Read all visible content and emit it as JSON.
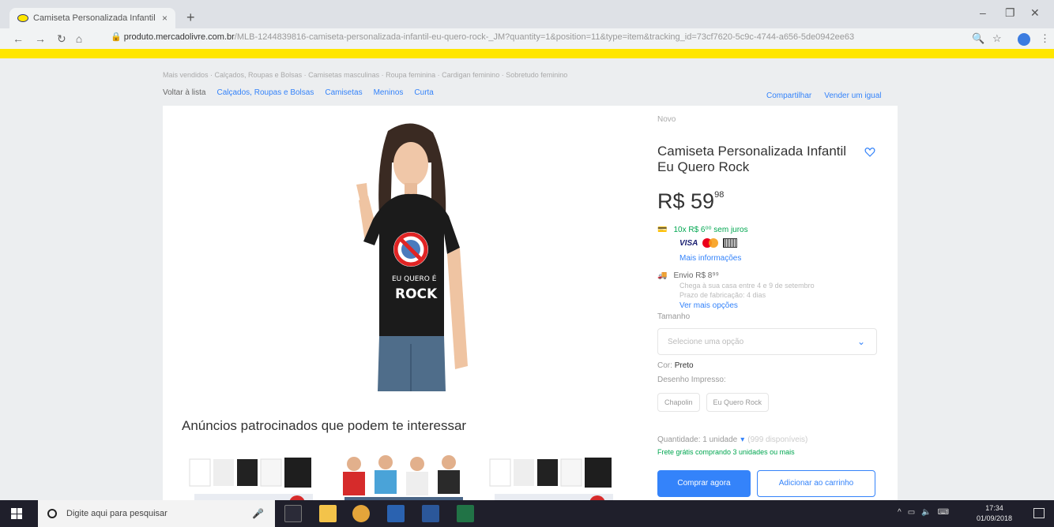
{
  "browser": {
    "tab_title": "Camiseta Personalizada Infantil",
    "tab_close": "×",
    "new_tab": "+",
    "url_host": "produto.mercadolivre.com.br",
    "url_path": "/MLB-1244839816-camiseta-personalizada-infantil-eu-quero-rock-_JM?quantity=1&position=11&type=item&tracking_id=73cf7620-5c9c-4744-a656-5de0942ee63"
  },
  "breadcrumb": {
    "top_trail": "Mais vendidos · Calçados, Roupas e Bolsas · Camisetas masculinas · Roupa feminina · Cardigan feminino · Sobretudo feminino",
    "back": "Voltar à lista",
    "items": [
      "Calçados, Roupas e Bolsas",
      "Camisetas",
      "Meninos",
      "Curta"
    ],
    "share": "Compartilhar",
    "sell": "Vender um igual"
  },
  "product": {
    "condition": "Novo",
    "title": "Camiseta Personalizada Infantil Eu Quero Rock",
    "currency": "R$",
    "price_int": "59",
    "price_cents": "98",
    "installments": "10x R$ 6⁰⁰ sem juros",
    "card_visa": "VISA",
    "more_info": "Mais informações",
    "shipping": "Envio R$ 8⁹⁹",
    "shipping_line1": "Chega à sua casa entre 4 e 9 de setembro",
    "shipping_line2": "Prazo de fabricação: 4 dias",
    "more_options": "Ver mais opções",
    "size_label": "Tamanho",
    "size_placeholder": "Selecione uma opção",
    "color_label": "Cor:",
    "color_value": "Preto",
    "print_label": "Desenho Impresso:",
    "print_options": [
      "Chapolin",
      "Eu Quero Rock"
    ],
    "qty_label": "Quantidade: 1 unidade",
    "qty_available": "(999 disponíveis)",
    "free_shipping": "Frete grátis comprando 3 unidades ou mais",
    "buy_now": "Comprar agora",
    "add_cart": "Adicionar ao carrinho"
  },
  "sponsored": {
    "heading": "Anúncios patrocinados que podem te interessar"
  },
  "taskbar": {
    "search_placeholder": "Digite aqui para pesquisar",
    "time": "17:34",
    "date": "01/09/2018"
  },
  "colors": {
    "brand_yellow": "#ffe600",
    "link_blue": "#3483fa",
    "green": "#00a650"
  }
}
